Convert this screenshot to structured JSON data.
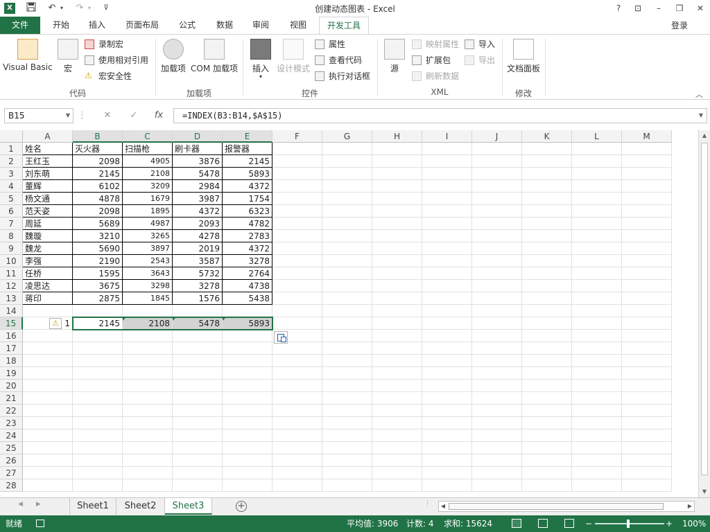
{
  "app": {
    "title": "创建动态图表 - Excel",
    "logo": "X",
    "window_buttons": [
      "?",
      "⊡",
      "–",
      "❐",
      "✕"
    ]
  },
  "quick_access": {
    "save_icon": "save-icon",
    "undo_icon": "undo-icon",
    "redo_icon": "redo-icon",
    "customize_icon": "customize-icon"
  },
  "tabs": [
    "文件",
    "开始",
    "插入",
    "页面布局",
    "公式",
    "数据",
    "审阅",
    "视图",
    "开发工具"
  ],
  "active_tab": "开发工具",
  "login": "登录",
  "ribbon": {
    "code": {
      "label": "代码",
      "visual_basic": "Visual Basic",
      "macros": "宏",
      "record_macro": "录制宏",
      "relative_ref": "使用相对引用",
      "macro_security": "宏安全性"
    },
    "addins": {
      "label": "加载项",
      "addins": "加载项",
      "com_addins": "COM 加载项"
    },
    "controls": {
      "label": "控件",
      "insert": "插入",
      "design_mode": "设计模式",
      "properties": "属性",
      "view_code": "查看代码",
      "run_dialog": "执行对话框"
    },
    "xml": {
      "label": "XML",
      "source": "源",
      "map_properties": "映射属性",
      "expansion_packs": "扩展包",
      "refresh_data": "刷新数据",
      "import": "导入",
      "export": "导出"
    },
    "modify": {
      "label": "修改",
      "document_panel": "文档面板"
    }
  },
  "formula_bar": {
    "name_box": "B15",
    "cancel": "✕",
    "enter": "✓",
    "fx": "fx",
    "formula": "=INDEX(B3:B14,$A$15)"
  },
  "columns": [
    "A",
    "B",
    "C",
    "D",
    "E",
    "F",
    "G",
    "H",
    "I",
    "J",
    "K",
    "L",
    "M"
  ],
  "rows": [
    "1",
    "2",
    "3",
    "4",
    "5",
    "6",
    "7",
    "8",
    "9",
    "10",
    "11",
    "12",
    "13",
    "14",
    "15",
    "16",
    "17",
    "18",
    "19",
    "20",
    "21",
    "22",
    "23",
    "24",
    "25",
    "26",
    "27",
    "28"
  ],
  "table": {
    "header": [
      "姓名",
      "灭火器",
      "扫描枪",
      "刷卡器",
      "报警器"
    ],
    "body": [
      [
        "王红玉",
        "2098",
        "4905",
        "3876",
        "2145"
      ],
      [
        "刘东萌",
        "2145",
        "2108",
        "5478",
        "5893"
      ],
      [
        "董辉",
        "6102",
        "3209",
        "2984",
        "4372"
      ],
      [
        "杨文通",
        "4878",
        "1679",
        "3987",
        "1754"
      ],
      [
        "范天姿",
        "2098",
        "1895",
        "4372",
        "6323"
      ],
      [
        "周延",
        "5689",
        "4987",
        "2093",
        "4782"
      ],
      [
        "魏璇",
        "3210",
        "3265",
        "4278",
        "2783"
      ],
      [
        "魏龙",
        "5690",
        "3897",
        "2019",
        "4372"
      ],
      [
        "李强",
        "2190",
        "2543",
        "3587",
        "3278"
      ],
      [
        "任桥",
        "1595",
        "3643",
        "5732",
        "2764"
      ],
      [
        "凌思达",
        "3675",
        "3298",
        "3278",
        "4738"
      ],
      [
        "蒋印",
        "2875",
        "1845",
        "1576",
        "5438"
      ]
    ]
  },
  "row15": {
    "a": "1",
    "values": [
      "2145",
      "2108",
      "5478",
      "5893"
    ]
  },
  "sheets": [
    "Sheet1",
    "Sheet2",
    "Sheet3"
  ],
  "active_sheet": "Sheet3",
  "status": {
    "ready": "就绪",
    "average": "平均值: 3906",
    "count": "计数: 4",
    "sum": "求和: 15624",
    "zoom": "100%"
  },
  "colors": {
    "accent": "#217346",
    "selection": "#d3d3d3"
  }
}
